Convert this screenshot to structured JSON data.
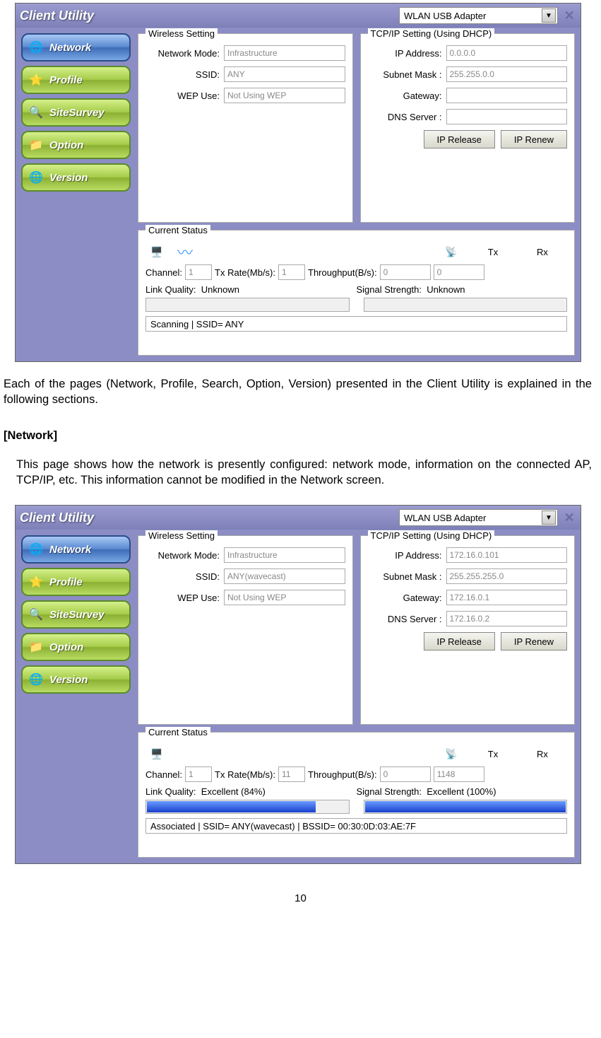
{
  "common": {
    "app_title": "Client Utility",
    "adapter": "WLAN USB Adapter",
    "nav": {
      "network": "Network",
      "profile": "Profile",
      "sitesurvey": "SiteSurvey",
      "option": "Option",
      "version": "Version"
    },
    "wireless": {
      "legend": "Wireless Setting",
      "network_mode_label": "Network Mode:",
      "ssid_label": "SSID:",
      "wep_label": "WEP Use:"
    },
    "tcpip": {
      "legend": "TCP/IP Setting  (Using DHCP)",
      "ip_label": "IP Address:",
      "subnet_label": "Subnet Mask :",
      "gateway_label": "Gateway:",
      "dns_label": "DNS Server :",
      "ip_release": "IP Release",
      "ip_renew": "IP Renew"
    },
    "status": {
      "legend": "Current Status",
      "channel_label": "Channel:",
      "txrate_label": "Tx Rate(Mb/s):",
      "throughput_label": "Throughput(B/s):",
      "tx_label": "Tx",
      "rx_label": "Rx",
      "link_quality_label": "Link Quality:",
      "signal_strength_label": "Signal Strength:"
    }
  },
  "shot1": {
    "wireless": {
      "mode": "Infrastructure",
      "ssid": "ANY",
      "wep": "Not Using WEP"
    },
    "tcpip": {
      "ip": "0.0.0.0",
      "subnet": "255.255.0.0",
      "gateway": "",
      "dns": ""
    },
    "status": {
      "channel": "1",
      "txrate": "1",
      "tx": "0",
      "rx": "0",
      "link_quality": "Unknown",
      "signal_strength": "Unknown",
      "lq_pct": 0,
      "ss_pct": 0,
      "statusbar": "Scanning | SSID= ANY"
    }
  },
  "shot2": {
    "wireless": {
      "mode": "Infrastructure",
      "ssid": "ANY(wavecast)",
      "wep": "Not Using WEP"
    },
    "tcpip": {
      "ip": "172.16.0.101",
      "subnet": "255.255.255.0",
      "gateway": "172.16.0.1",
      "dns": "172.16.0.2"
    },
    "status": {
      "channel": "1",
      "txrate": "11",
      "tx": "0",
      "rx": "1148",
      "link_quality": "Excellent (84%)",
      "signal_strength": "Excellent (100%)",
      "lq_pct": 84,
      "ss_pct": 100,
      "statusbar": "Associated | SSID= ANY(wavecast) | BSSID= 00:30:0D:03:AE:7F"
    }
  },
  "doc": {
    "para1": "Each of the pages (Network, Profile, Search, Option, Version) presented in the Client Utility is explained in the following sections.",
    "section_head": "[Network]",
    "para2": "This page shows how the network is presently configured: network mode, information on the connected AP, TCP/IP, etc. This information cannot be modified in the Network screen.",
    "page_number": "10"
  }
}
